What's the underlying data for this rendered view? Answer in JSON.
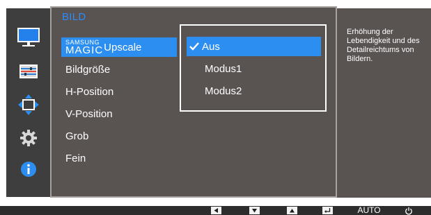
{
  "sidebar": {
    "icons": [
      {
        "name": "monitor-icon",
        "state": "active"
      },
      {
        "name": "settings-panel-icon"
      },
      {
        "name": "position-arrows-icon"
      },
      {
        "name": "gear-icon"
      },
      {
        "name": "info-icon"
      }
    ]
  },
  "panel": {
    "title": "BILD",
    "menu": [
      {
        "brand_top": "SAMSUNG",
        "brand_bottom": "MAGIC",
        "label": "Upscale",
        "selected": true
      },
      {
        "label": "Bildgröße"
      },
      {
        "label": "H-Position"
      },
      {
        "label": "V-Position"
      },
      {
        "label": "Grob"
      },
      {
        "label": "Fein"
      }
    ]
  },
  "submenu": {
    "options": [
      {
        "label": "Aus",
        "selected": true
      },
      {
        "label": "Modus1"
      },
      {
        "label": "Modus2"
      }
    ]
  },
  "help": {
    "text": "Erhöhung der Lebendigkeit und des Detailreichtums von Bildern."
  },
  "bottom_bar": {
    "buttons": [
      {
        "name": "left-arrow-icon"
      },
      {
        "name": "down-arrow-icon"
      },
      {
        "name": "up-arrow-icon"
      },
      {
        "name": "enter-icon"
      },
      {
        "name": "auto-button",
        "label": "AUTO"
      },
      {
        "name": "power-icon"
      }
    ]
  },
  "colors": {
    "accent": "#2b8ef0",
    "title": "#2c8cf4",
    "panel": "#595352",
    "icon_bar": "#3e3e3e",
    "bottom_bar": "#2d2d2d"
  }
}
